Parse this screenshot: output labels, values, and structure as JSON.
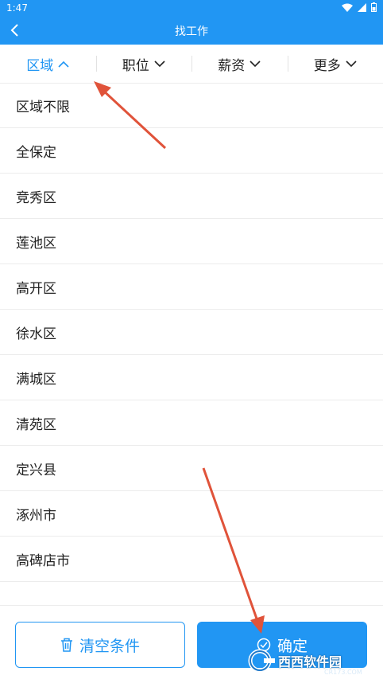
{
  "status_bar": {
    "time": "1:47"
  },
  "app_bar": {
    "title": "找工作"
  },
  "filters": [
    {
      "label": "区域",
      "active": true
    },
    {
      "label": "职位",
      "active": false
    },
    {
      "label": "薪资",
      "active": false
    },
    {
      "label": "更多",
      "active": false
    }
  ],
  "areas": [
    "区域不限",
    "全保定",
    "竞秀区",
    "莲池区",
    "高开区",
    "徐水区",
    "满城区",
    "清苑区",
    "定兴县",
    "涿州市",
    "高碑店市"
  ],
  "buttons": {
    "clear": "清空条件",
    "confirm": "确定"
  },
  "watermark": {
    "text": "西西软件园",
    "sub": "CR173.COM"
  },
  "colors": {
    "primary": "#2196f3",
    "annotation": "#e0533a"
  }
}
